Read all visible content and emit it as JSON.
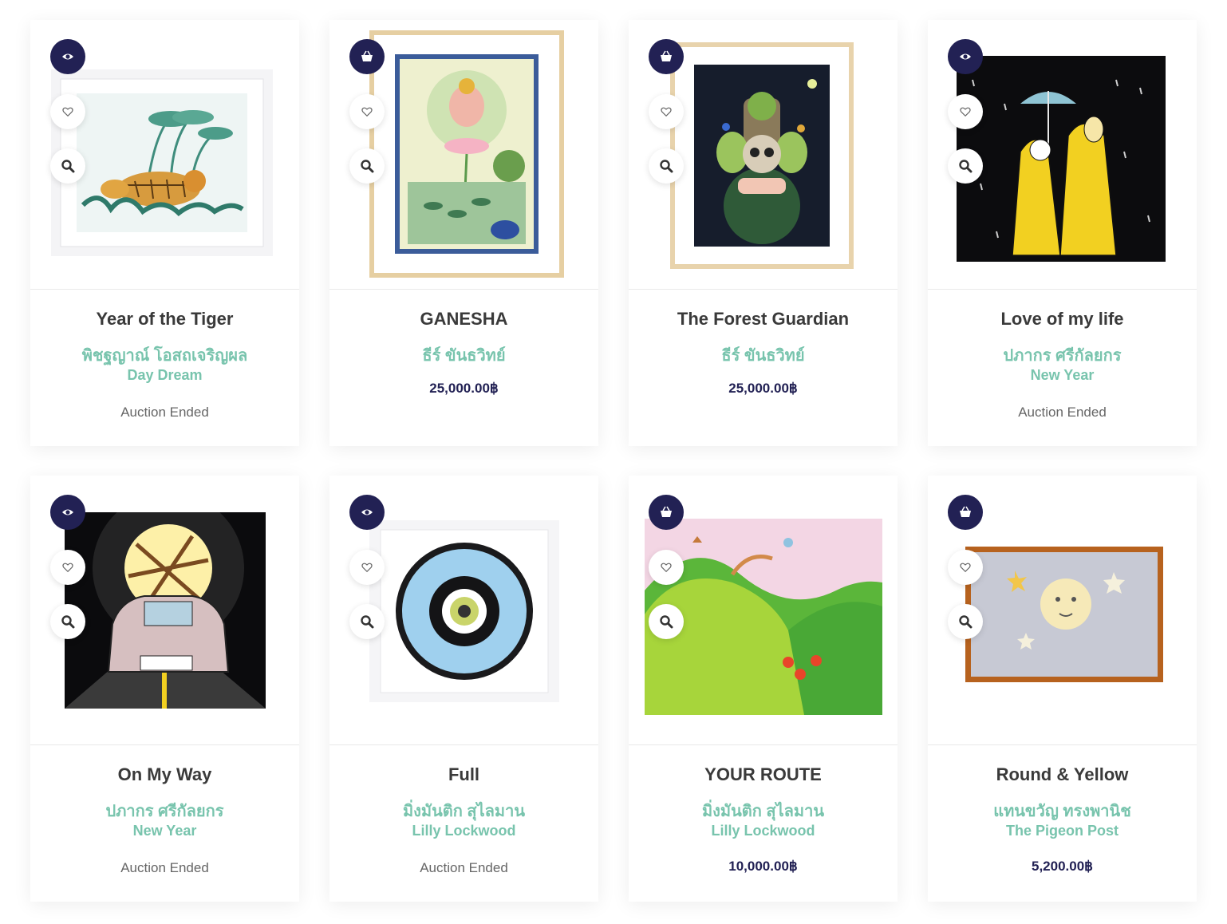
{
  "theme": {
    "accent": "#222154",
    "artist_color": "#78c4ad",
    "title_color": "#3a3a3a",
    "status_color": "#666666"
  },
  "products": [
    {
      "title": "Year of the Tiger",
      "artist": "พิชฐญาณ์ โอสถเจริญผล",
      "collection": "Day Dream",
      "status": "Auction Ended",
      "price": "",
      "primary_icon": "eye-icon"
    },
    {
      "title": "GANESHA",
      "artist": "ธีร์ ขันธวิทย์",
      "collection": "",
      "status": "",
      "price": "25,000.00฿",
      "primary_icon": "basket-icon"
    },
    {
      "title": "The Forest Guardian",
      "artist": "ธีร์ ขันธวิทย์",
      "collection": "",
      "status": "",
      "price": "25,000.00฿",
      "primary_icon": "basket-icon"
    },
    {
      "title": "Love of my life",
      "artist": "ปภากร ศรีกัลยกร",
      "collection": "New Year",
      "status": "Auction Ended",
      "price": "",
      "primary_icon": "eye-icon"
    },
    {
      "title": "On My Way",
      "artist": "ปภากร ศรีกัลยกร",
      "collection": "New Year",
      "status": "Auction Ended",
      "price": "",
      "primary_icon": "eye-icon"
    },
    {
      "title": "Full",
      "artist": "มิ่งมันติก สุไลมาน",
      "collection": "Lilly Lockwood",
      "status": "Auction Ended",
      "price": "",
      "primary_icon": "eye-icon"
    },
    {
      "title": "YOUR ROUTE",
      "artist": "มิ่งมันติก สุไลมาน",
      "collection": "Lilly Lockwood",
      "status": "",
      "price": "10,000.00฿",
      "primary_icon": "basket-icon"
    },
    {
      "title": "Round & Yellow",
      "artist": "แทนขวัญ ทรงพานิช",
      "collection": "The Pigeon Post",
      "status": "",
      "price": "5,200.00฿",
      "primary_icon": "basket-icon"
    }
  ]
}
